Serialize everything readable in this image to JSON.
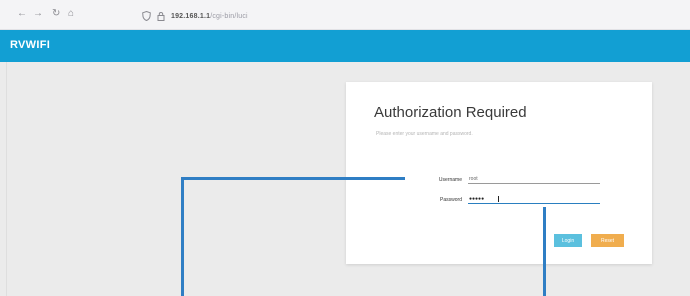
{
  "browser": {
    "back_icon": "←",
    "forward_icon": "→",
    "reload_icon": "↻",
    "home_icon": "⌂",
    "url_host": "192.168.1.1",
    "url_path": "/cgi-bin/luci"
  },
  "header": {
    "brand": "RVWIFI",
    "color": "#129fd3"
  },
  "login": {
    "title": "Authorization Required",
    "subtitle": "Please enter your username and password.",
    "username_label": "Username",
    "username_value": "root",
    "password_label": "Password",
    "password_value": "●●●●●",
    "login_button": "Login",
    "reset_button": "Reset"
  },
  "colors": {
    "login_button": "#5bc0de",
    "reset_button": "#f0ad4e",
    "callout": "#2f7ec4"
  }
}
